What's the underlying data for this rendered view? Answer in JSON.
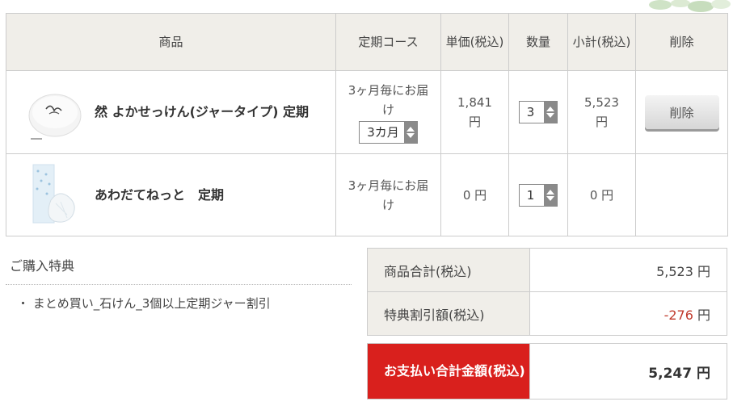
{
  "cart": {
    "headers": {
      "product": "商品",
      "course": "定期コース",
      "unit_price": "単価(税込)",
      "quantity": "数量",
      "subtotal": "小計(税込)",
      "delete": "削除"
    },
    "rows": [
      {
        "name": "然 よかせっけん(ジャータイプ) 定期",
        "course_text": "3ヶ月毎にお届け",
        "course_select": "3カ月",
        "unit_price": "1,841",
        "unit_price_yen": "円",
        "quantity": "3",
        "subtotal": "5,523",
        "subtotal_yen": "円",
        "delete_label": "削除"
      },
      {
        "name": "あわだてねっと　定期",
        "course_text": "3ヶ月毎にお届け",
        "unit_price": "0 円",
        "quantity": "1",
        "subtotal": "0 円"
      }
    ]
  },
  "benefit": {
    "title": "ご購入特典",
    "items": [
      "・ まとめ買い_石けん_3個以上定期ジャー割引"
    ]
  },
  "totals": {
    "goods_label": "商品合計(税込)",
    "goods_value": "5,523",
    "discount_label": "特典割引額(税込)",
    "discount_value": "-276",
    "yen": "円",
    "grand_label": "お支払い合計金額(税込)",
    "grand_value": "5,247"
  },
  "colors": {
    "header_bg": "#f0eee9",
    "accent_red": "#d9201d",
    "negative": "#c0392b"
  }
}
